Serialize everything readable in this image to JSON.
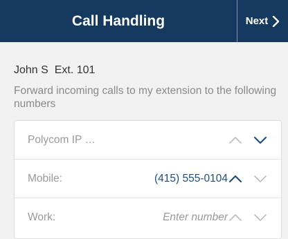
{
  "header": {
    "title": "Call Handling",
    "next_label": "Next"
  },
  "user_line": "John S  Ext. 101",
  "description": "Forward incoming calls to my extension to the following numbers",
  "rows": [
    {
      "label": "Polycom IP …",
      "value": "",
      "placeholder": ""
    },
    {
      "label": "Mobile:",
      "value": "(415) 555-0104",
      "placeholder": ""
    },
    {
      "label": "Work:",
      "value": "",
      "placeholder": "Enter number"
    }
  ],
  "icons": {
    "next": "chevron-right-icon",
    "move_up": "chevron-up-icon",
    "move_down": "chevron-down-icon"
  },
  "colors": {
    "header_bg": "#163a5f",
    "accent": "#1f4e79",
    "disabled": "#bbbbbb"
  }
}
